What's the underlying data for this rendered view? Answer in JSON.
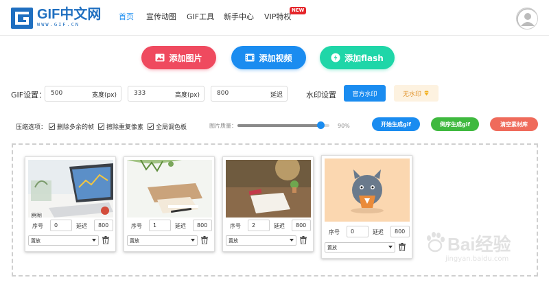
{
  "header": {
    "logo_text": "GIF中文网",
    "logo_url": "WWW.GIF.CN",
    "nav": [
      {
        "label": "首页",
        "active": true
      },
      {
        "label": "宣传动图",
        "active": false
      },
      {
        "label": "GIF工具",
        "active": false
      },
      {
        "label": "新手中心",
        "active": false
      },
      {
        "label": "VIP特权",
        "active": false
      }
    ],
    "vip_badge": "NEW",
    "avatar_icon": "user-avatar-icon"
  },
  "actions": {
    "add_image": "添加图片",
    "add_video": "添加视频",
    "add_flash": "添加flash"
  },
  "gif_settings": {
    "label": "GIF设置：",
    "width_value": "500",
    "width_unit": "宽度(px)",
    "height_value": "333",
    "height_unit": "高度(px)",
    "delay_value": "800",
    "delay_unit": "延迟",
    "watermark_label": "水印设置",
    "official_watermark": "官方水印",
    "no_watermark": "无水印"
  },
  "compression": {
    "label": "压缩选项：",
    "options": [
      "删除多余的帧",
      "擦除重复像素",
      "全局调色板"
    ],
    "quality_label": "图片质量：",
    "quality_value": 0.9,
    "quality_text": "90%",
    "generate_gif": "开始生成gif",
    "generate_reverse": "倒序生成gif",
    "clear_materials": "清空素材库"
  },
  "frames": [
    {
      "tag": "原图",
      "index_label": "序号",
      "index": "0",
      "delay_label": "延迟",
      "delay": "800",
      "disposal": "置放"
    },
    {
      "tag": "",
      "index_label": "序号",
      "index": "1",
      "delay_label": "延迟",
      "delay": "800",
      "disposal": "置放"
    },
    {
      "tag": "",
      "index_label": "序号",
      "index": "2",
      "delay_label": "延迟",
      "delay": "800",
      "disposal": "置放"
    },
    {
      "tag": "",
      "index_label": "序号",
      "index": "0",
      "delay_label": "延迟",
      "delay": "800",
      "disposal": "置放"
    }
  ],
  "watermark_overlay": {
    "main": "Bai经验",
    "sub": "jingyan.baidu.com"
  },
  "colors": {
    "primary": "#1a8cf0",
    "red": "#ef4a5f",
    "green": "#1fd6a8"
  }
}
